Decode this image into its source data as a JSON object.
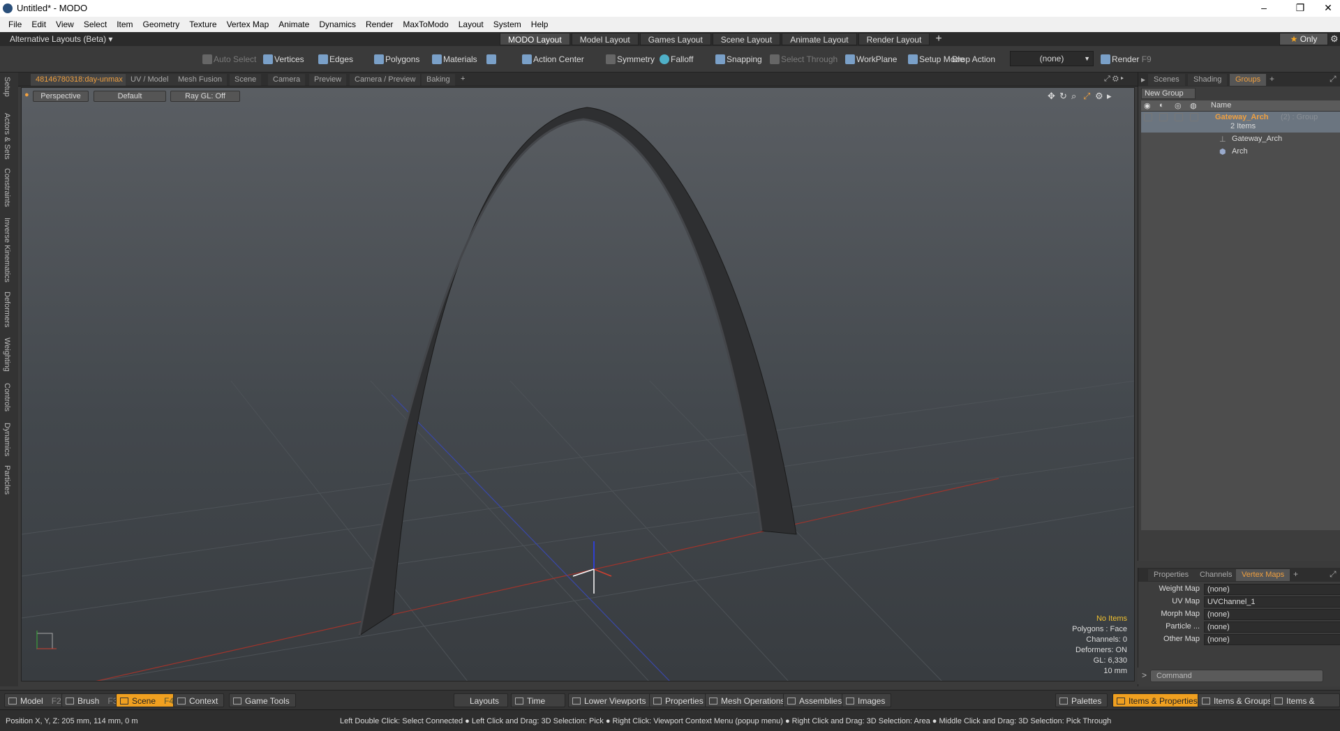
{
  "window": {
    "title": "Untitled* - MODO",
    "min": "–",
    "max": "❐",
    "close": "✕"
  },
  "menu": [
    "File",
    "Edit",
    "View",
    "Select",
    "Item",
    "Geometry",
    "Texture",
    "Vertex Map",
    "Animate",
    "Dynamics",
    "Render",
    "MaxToModo",
    "Layout",
    "System",
    "Help"
  ],
  "layoutbar": {
    "alt_layouts": "Alternative Layouts (Beta) ▾",
    "tabs": [
      "MODO Layout",
      "Model Layout",
      "Games Layout",
      "Scene Layout",
      "Animate Layout",
      "Render Layout"
    ],
    "plus": "+",
    "only": "Only",
    "star": "★",
    "gear": "⚙"
  },
  "toolbar": {
    "auto_select": "Auto Select",
    "vertices": "Vertices",
    "edges": "Edges",
    "polygons": "Polygons",
    "materials": "Materials",
    "action_center": "Action Center",
    "symmetry": "Symmetry",
    "falloff": "Falloff",
    "snapping": "Snapping",
    "select_through": "Select Through",
    "workplane": "WorkPlane",
    "setup_mode": "Setup Mode",
    "drop_action": "Drop Action",
    "drop_value": "(none)",
    "render": "Render",
    "render_key": "F9"
  },
  "left_tabs": [
    "Setup",
    "Actors & Sets",
    "Constraints",
    "Inverse Kinematics",
    "Deformers",
    "Weighting",
    "Controls",
    "Dynamics",
    "Particles"
  ],
  "viewport_tabs": [
    "48146780318:day-unmax",
    "UV / Model",
    "Mesh Fusion",
    "Scene",
    "Camera",
    "Preview",
    "Camera / Preview",
    "Baking"
  ],
  "viewport_tab_plus": "+",
  "viewport": {
    "projection": "Perspective",
    "style": "Default",
    "raygl": "Ray GL: Off",
    "info": {
      "items": "No Items",
      "polygons": "Polygons : Face",
      "channels": "Channels: 0",
      "deformers": "Deformers: ON",
      "gl": "GL: 6,330",
      "scale": "10 mm"
    }
  },
  "right_panel": {
    "tabs": [
      "Scenes",
      "Shading",
      "Groups"
    ],
    "plus": "+",
    "new_group": "New Group",
    "col_name": "Name",
    "group": {
      "name": "Gateway_Arch",
      "meta": "(2) : Group",
      "count": "2 Items"
    },
    "children": [
      "Gateway_Arch",
      "Arch"
    ]
  },
  "vertex_maps": {
    "tabs": [
      "Properties",
      "Channels",
      "Vertex Maps"
    ],
    "plus": "+",
    "rows": [
      {
        "label": "Weight Map",
        "value": "(none)"
      },
      {
        "label": "UV Map",
        "value": "UVChannel_1"
      },
      {
        "label": "Morph Map",
        "value": "(none)"
      },
      {
        "label": "Particle  ...",
        "value": "(none)"
      },
      {
        "label": "Other Map",
        "value": "(none)"
      }
    ]
  },
  "command": {
    "prompt": ">",
    "placeholder": "Command"
  },
  "bottom": {
    "model": "Model",
    "model_key": "F2",
    "brush": "Brush",
    "brush_key": "F3",
    "scene": "Scene",
    "scene_key": "F4",
    "context": "Context",
    "game_tools": "Game Tools",
    "layouts": "Layouts",
    "time": "Time",
    "lower_viewports": "Lower Viewports",
    "properties": "Properties",
    "mesh_ops": "Mesh Operations",
    "assemblies": "Assemblies",
    "images": "Images",
    "palettes": "Palettes",
    "items_props": "Items & Properties",
    "items_groups": "Items & Groups",
    "items_shading": "Items & Shading"
  },
  "status": {
    "position": "Position X, Y, Z:   205 mm, 114 mm, 0 m",
    "hints": "Left Double Click: Select Connected ● Left Click and Drag: 3D Selection: Pick ● Right Click: Viewport Context Menu (popup menu) ● Right Click and Drag: 3D Selection: Area ● Middle Click and Drag: 3D Selection: Pick Through"
  }
}
